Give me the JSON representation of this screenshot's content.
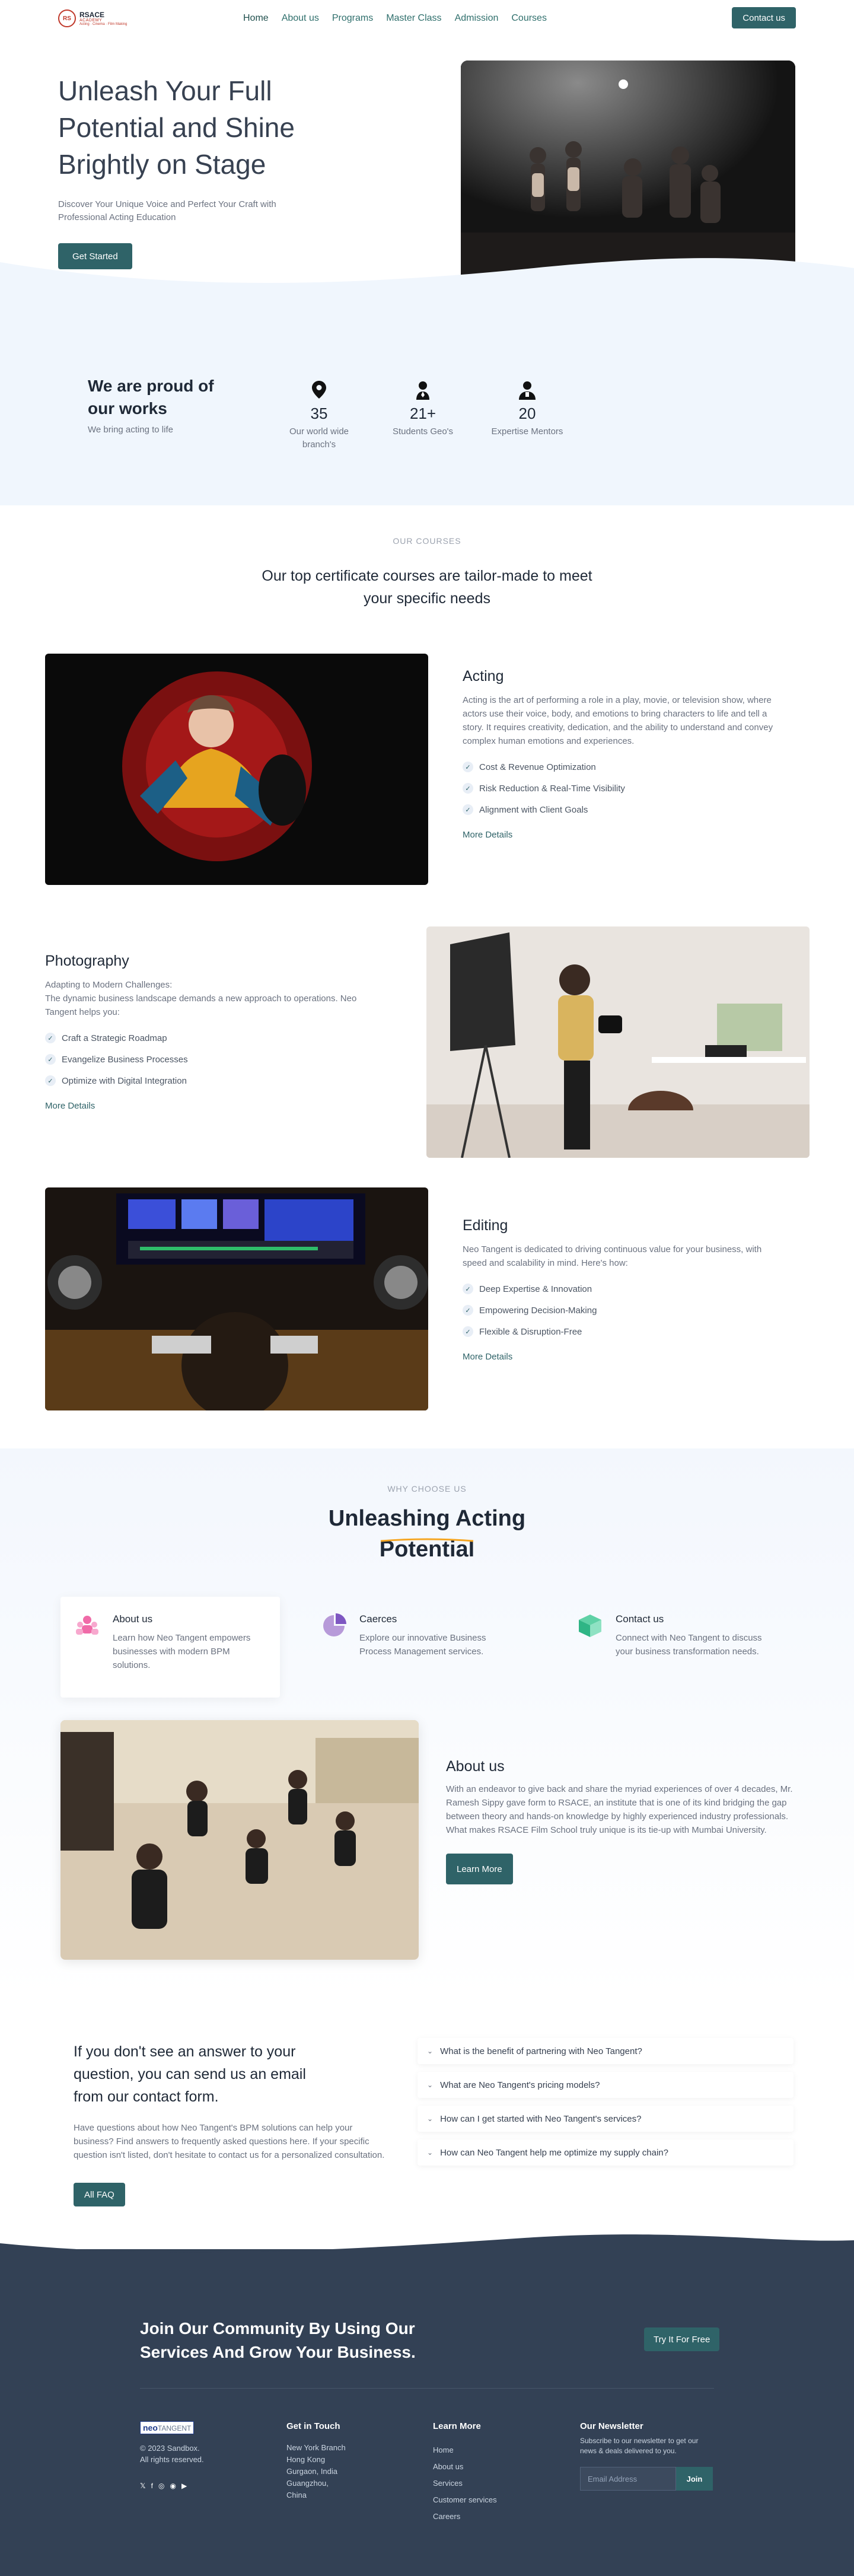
{
  "nav": {
    "logo_line1": "RSACE",
    "logo_line2": "ACADEMY",
    "logo_line3": "Acting · Cinema · Film Making",
    "links": [
      "Home",
      "About us",
      "Programs",
      "Master Class",
      "Admission",
      "Courses"
    ],
    "cta": "Contact us"
  },
  "hero": {
    "title": "Unleash Your Full Potential and Shine Brightly on Stage",
    "subtitle": "Discover Your Unique Voice and Perfect Your Craft with Professional Acting Education",
    "button": "Get Started"
  },
  "stats": {
    "heading": "We are proud of our works",
    "subheading": "We bring acting to life",
    "items": [
      {
        "icon": "location-pin-icon",
        "number": "35",
        "label": "Our world wide branch's"
      },
      {
        "icon": "student-icon",
        "number": "21+",
        "label": "Students Geo's"
      },
      {
        "icon": "mentor-icon",
        "number": "20",
        "label": "Expertise Mentors"
      }
    ]
  },
  "courses": {
    "eyebrow": "OUR COURSES",
    "title": "Our top certificate courses are tailor-made to meet your specific needs",
    "list": [
      {
        "title": "Acting",
        "description": "Acting is the art of performing a role in a play, movie, or television show, where actors use their voice, body, and emotions to bring characters to life and tell a story. It requires creativity, dedication, and the ability to understand and convey complex human emotions and experiences.",
        "bullets": [
          "Cost & Revenue Optimization",
          "Risk Reduction & Real-Time Visibility",
          "Alignment with Client Goals"
        ],
        "more": "More Details"
      },
      {
        "title": "Photography",
        "description": "Adapting to Modern Challenges:\nThe dynamic business landscape demands a new approach to operations. Neo Tangent helps you:",
        "bullets": [
          "Craft a Strategic Roadmap",
          "Evangelize Business Processes",
          "Optimize with Digital Integration"
        ],
        "more": "More Details"
      },
      {
        "title": "Editing",
        "description": "Neo Tangent is dedicated to driving continuous value for your business, with speed and scalability in mind. Here's how:",
        "bullets": [
          "Deep Expertise & Innovation",
          "Empowering Decision-Making",
          "Flexible & Disruption-Free"
        ],
        "more": "More Details"
      }
    ]
  },
  "why": {
    "eyebrow": "WHY CHOOSE US",
    "title_line1": "Unleashing Acting",
    "title_line2": "Potential",
    "features": [
      {
        "icon": "team-icon",
        "title": "About us",
        "text": "Learn how Neo Tangent empowers businesses with modern BPM solutions."
      },
      {
        "icon": "pie-chart-icon",
        "title": "Caerces",
        "text": "Explore our innovative Business Process Management services."
      },
      {
        "icon": "box-icon",
        "title": "Contact us",
        "text": "Connect with Neo Tangent to discuss your business transformation needs."
      }
    ],
    "about": {
      "title": "About us",
      "text": "With an endeavor to give back and share the myriad experiences of over 4 decades, Mr. Ramesh Sippy gave form to RSACE, an institute that is one of its kind bridging the gap between theory and hands-on knowledge by highly experienced industry professionals.\nWhat makes RSACE Film School truly unique is its tie-up with Mumbai University.",
      "button": "Learn More"
    }
  },
  "faq": {
    "title": "If you don't see an answer to your question, you can send us an email from our contact form.",
    "description": "Have questions about how Neo Tangent's BPM solutions can help your business? Find answers to frequently asked questions here. If your specific question isn't listed, don't hesitate to contact us for a personalized consultation.",
    "button": "All FAQ",
    "questions": [
      "What is the benefit of partnering with Neo Tangent?",
      "What are Neo Tangent's pricing models?",
      "How can I get started with Neo Tangent's services?",
      "How can Neo Tangent help me optimize my supply chain?"
    ]
  },
  "footer": {
    "cta_title": "Join Our Community By Using Our Services And Grow Your Business.",
    "cta_button": "Try It For Free",
    "logo_main": "neo",
    "logo_sub": "TANGENT",
    "copyright_line1": "© 2023 Sandbox.",
    "copyright_line2": "All rights reserved.",
    "social": [
      "twitter-icon",
      "facebook-icon",
      "dribbble-icon",
      "instagram-icon",
      "youtube-icon"
    ],
    "contact_title": "Get in Touch",
    "contact_lines": [
      "New York Branch",
      "Hong Kong",
      "Gurgaon, India",
      "Guangzhou,",
      "China"
    ],
    "learn_title": "Learn More",
    "learn_links": [
      "Home",
      "About us",
      "Services",
      "Customer services",
      "Careers"
    ],
    "newsletter_title": "Our Newsletter",
    "newsletter_text": "Subscribe to our newsletter to get our news & deals delivered to you.",
    "email_placeholder": "Email Address",
    "join_button": "Join"
  },
  "colors": {
    "primary": "#2f6368",
    "stats_bg": "#f0f6fd",
    "footer_bg": "#334155",
    "accent_underline": "#f5a623"
  }
}
